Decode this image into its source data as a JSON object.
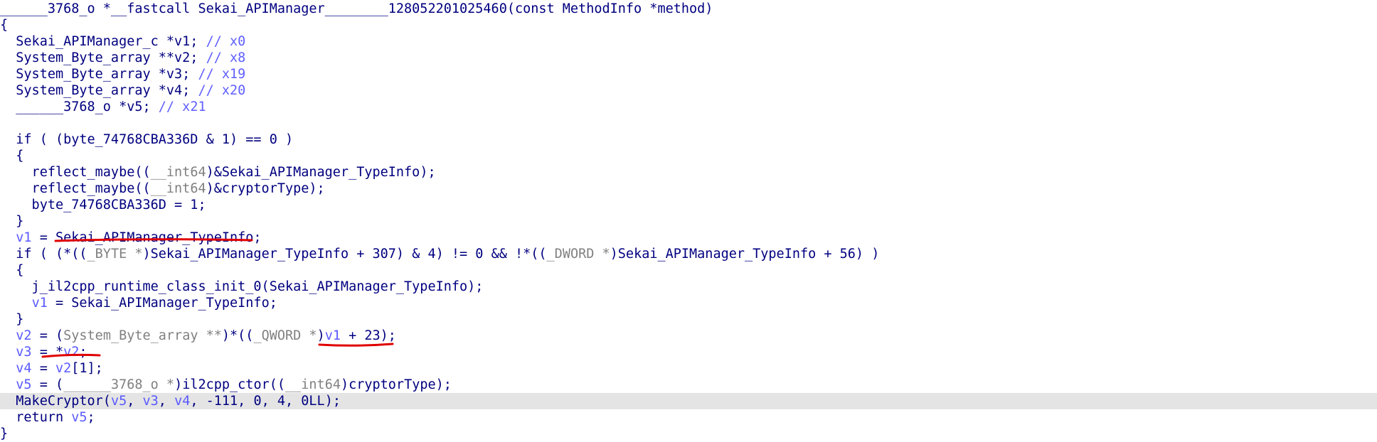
{
  "editor": {
    "highlight_color": "#e4e4e4",
    "annotation_color": "#e00000",
    "highlighted_line": 24,
    "lines": [
      [
        {
          "t": "______3768_o *__fastcall Sekai_APIManager________128052201025460(const MethodInfo *method)",
          "c": "k"
        }
      ],
      [
        {
          "t": "{",
          "c": "k"
        }
      ],
      [
        {
          "t": "  Sekai_APIManager_c *v1; ",
          "c": "k"
        },
        {
          "t": "// x0",
          "c": "c"
        }
      ],
      [
        {
          "t": "  System_Byte_array **v2; ",
          "c": "k"
        },
        {
          "t": "// x8",
          "c": "c"
        }
      ],
      [
        {
          "t": "  System_Byte_array *v3; ",
          "c": "k"
        },
        {
          "t": "// x19",
          "c": "c"
        }
      ],
      [
        {
          "t": "  System_Byte_array *v4; ",
          "c": "k"
        },
        {
          "t": "// x20",
          "c": "c"
        }
      ],
      [
        {
          "t": "  ______3768_o *v5; ",
          "c": "k"
        },
        {
          "t": "// x21",
          "c": "c"
        }
      ],
      [
        {
          "t": "",
          "c": "k"
        }
      ],
      [
        {
          "t": "  if ( (byte_74768CBA336D & 1) == 0 )",
          "c": "k"
        }
      ],
      [
        {
          "t": "  {",
          "c": "k"
        }
      ],
      [
        {
          "t": "    reflect_maybe((",
          "c": "k"
        },
        {
          "t": "__int64",
          "c": "g"
        },
        {
          "t": ")&Sekai_APIManager_TypeInfo);",
          "c": "k"
        }
      ],
      [
        {
          "t": "    reflect_maybe((",
          "c": "k"
        },
        {
          "t": "__int64",
          "c": "g"
        },
        {
          "t": ")&cryptorType);",
          "c": "k"
        }
      ],
      [
        {
          "t": "    byte_74768CBA336D = 1;",
          "c": "k"
        }
      ],
      [
        {
          "t": "  }",
          "c": "k"
        }
      ],
      [
        {
          "t": "  ",
          "c": "k"
        },
        {
          "t": "v1",
          "c": "v"
        },
        {
          "t": " = Sekai_APIManager_TypeInfo;",
          "c": "k"
        }
      ],
      [
        {
          "t": "  if ( (*((",
          "c": "k"
        },
        {
          "t": "_BYTE *",
          "c": "g"
        },
        {
          "t": ")Sekai_APIManager_TypeInfo + 307) & 4) != 0 && !*((",
          "c": "k"
        },
        {
          "t": "_DWORD *",
          "c": "g"
        },
        {
          "t": ")Sekai_APIManager_TypeInfo + 56) )",
          "c": "k"
        }
      ],
      [
        {
          "t": "  {",
          "c": "k"
        }
      ],
      [
        {
          "t": "    j_il2cpp_runtime_class_init_0(Sekai_APIManager_TypeInfo);",
          "c": "k"
        }
      ],
      [
        {
          "t": "    ",
          "c": "k"
        },
        {
          "t": "v1",
          "c": "v"
        },
        {
          "t": " = Sekai_APIManager_TypeInfo;",
          "c": "k"
        }
      ],
      [
        {
          "t": "  }",
          "c": "k"
        }
      ],
      [
        {
          "t": "  ",
          "c": "k"
        },
        {
          "t": "v2",
          "c": "v"
        },
        {
          "t": " = (",
          "c": "k"
        },
        {
          "t": "System_Byte_array **",
          "c": "g"
        },
        {
          "t": ")*((",
          "c": "k"
        },
        {
          "t": "_QWORD *",
          "c": "g"
        },
        {
          "t": ")",
          "c": "k"
        },
        {
          "t": "v1",
          "c": "v"
        },
        {
          "t": " + 23);",
          "c": "k"
        }
      ],
      [
        {
          "t": "  ",
          "c": "k"
        },
        {
          "t": "v3",
          "c": "v"
        },
        {
          "t": " = *",
          "c": "k"
        },
        {
          "t": "v2",
          "c": "v"
        },
        {
          "t": ";",
          "c": "k"
        }
      ],
      [
        {
          "t": "  ",
          "c": "k"
        },
        {
          "t": "v4",
          "c": "v"
        },
        {
          "t": " = ",
          "c": "k"
        },
        {
          "t": "v2",
          "c": "v"
        },
        {
          "t": "[1];",
          "c": "k"
        }
      ],
      [
        {
          "t": "  ",
          "c": "k"
        },
        {
          "t": "v5",
          "c": "v"
        },
        {
          "t": " = (",
          "c": "k"
        },
        {
          "t": "______3768_o *",
          "c": "g"
        },
        {
          "t": ")il2cpp_ctor((",
          "c": "k"
        },
        {
          "t": "__int64",
          "c": "g"
        },
        {
          "t": ")cryptorType);",
          "c": "k"
        }
      ],
      [
        {
          "t": "  MakeCryptor(",
          "c": "k"
        },
        {
          "t": "v5",
          "c": "v"
        },
        {
          "t": ", ",
          "c": "k"
        },
        {
          "t": "v3",
          "c": "v"
        },
        {
          "t": ", ",
          "c": "k"
        },
        {
          "t": "v4",
          "c": "v"
        },
        {
          "t": ", -111, 0, 4, 0LL);",
          "c": "k"
        }
      ],
      [
        {
          "t": "  return ",
          "c": "k"
        },
        {
          "t": "v5",
          "c": "v"
        },
        {
          "t": ";",
          "c": "k"
        }
      ],
      [
        {
          "t": "}",
          "c": "k"
        }
      ]
    ]
  }
}
